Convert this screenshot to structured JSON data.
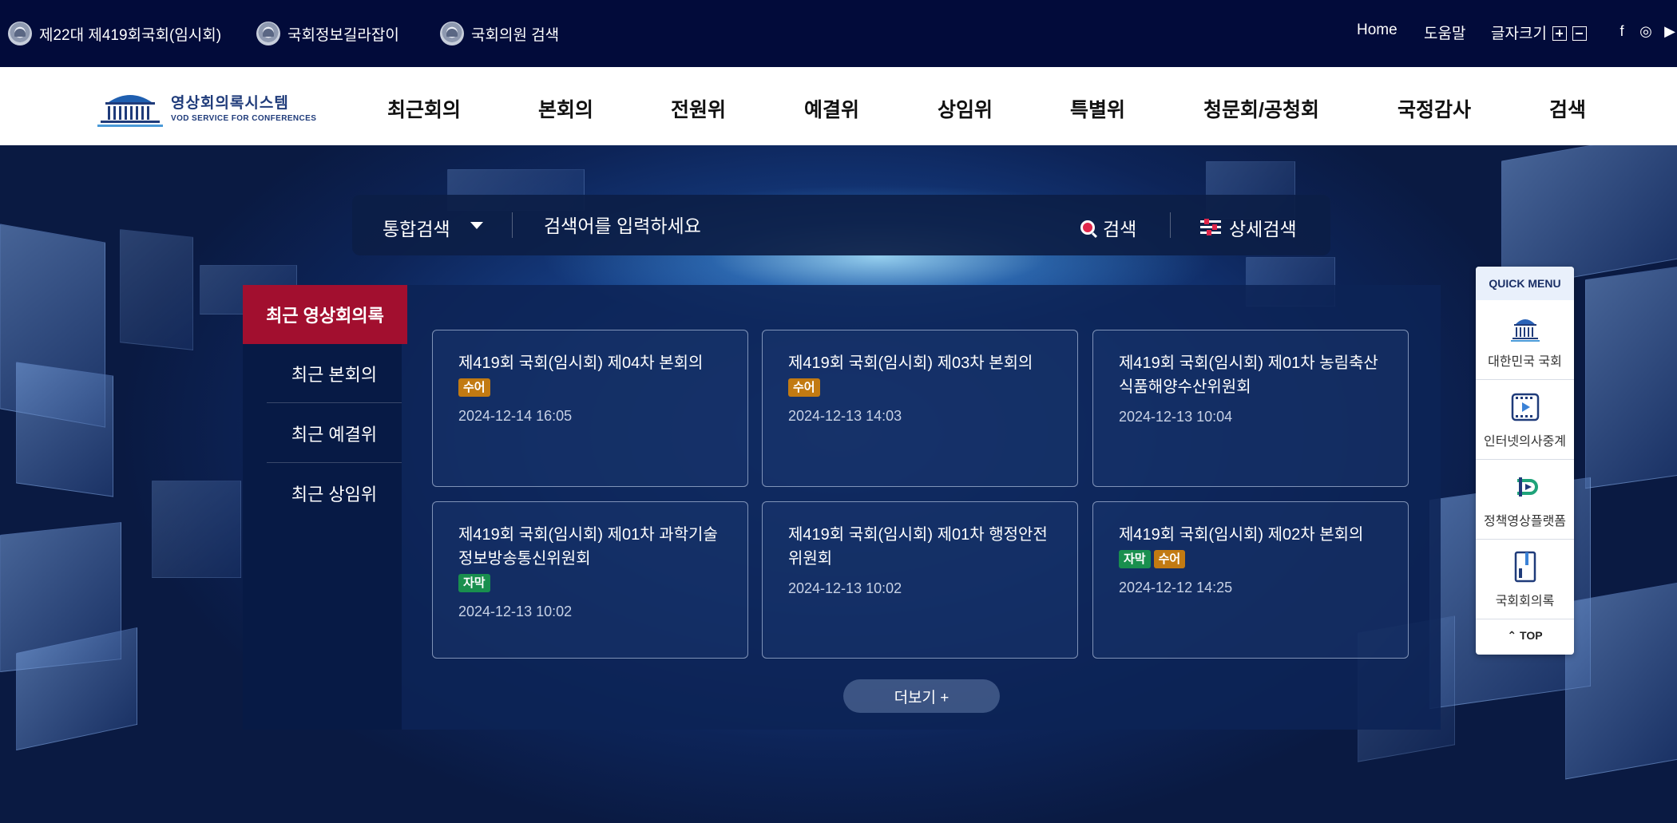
{
  "topbar": {
    "links": [
      "제22대 제419회국회(임시회)",
      "국회정보길라잡이",
      "국회의원 검색"
    ],
    "home": "Home",
    "help": "도움말",
    "font_size": "글자크기",
    "social": [
      "f",
      "◎",
      "▶"
    ]
  },
  "logo": {
    "title": "영상회의록시스템",
    "subtitle": "VOD SERVICE FOR CONFERENCES"
  },
  "nav": [
    "최근회의",
    "본회의",
    "전원위",
    "예결위",
    "상임위",
    "특별위",
    "청문회/공청회",
    "국정감사",
    "검색"
  ],
  "search": {
    "scope": "통합검색",
    "placeholder": "검색어를 입력하세요",
    "search_button": "검색",
    "advanced_button": "상세검색"
  },
  "tabs": {
    "active": "최근 영상회의록",
    "items": [
      "최근 본회의",
      "최근 예결위",
      "최근 상임위"
    ]
  },
  "cards": [
    {
      "title": "제419회 국회(임시회) 제04차 본회의",
      "badges": [
        "수어"
      ],
      "date": "2024-12-14 16:05"
    },
    {
      "title": "제419회 국회(임시회) 제03차 본회의",
      "badges": [
        "수어"
      ],
      "date": "2024-12-13 14:03"
    },
    {
      "title": "제419회 국회(임시회) 제01차 농림축산식품해양수산위원회",
      "badges": [],
      "date": "2024-12-13 10:04"
    },
    {
      "title": "제419회 국회(임시회) 제01차 과학기술정보방송통신위원회",
      "badges": [
        "자막"
      ],
      "date": "2024-12-13 10:02"
    },
    {
      "title": "제419회 국회(임시회) 제01차 행정안전위원회",
      "badges": [],
      "date": "2024-12-13 10:02"
    },
    {
      "title": "제419회 국회(임시회) 제02차 본회의",
      "badges": [
        "자막",
        "수어"
      ],
      "date": "2024-12-12 14:25"
    }
  ],
  "more_button": "더보기 +",
  "quick_menu": {
    "title": "QUICK MENU",
    "items": [
      "대한민국 국회",
      "인터넷의사중계",
      "정책영상플랫폼",
      "국회회의록"
    ],
    "top": "TOP"
  },
  "colors": {
    "topbar_bg": "#020b3a",
    "active_tab": "#a20f2f",
    "badge_sueo": "#c27a12",
    "badge_jamak": "#198f4e"
  }
}
